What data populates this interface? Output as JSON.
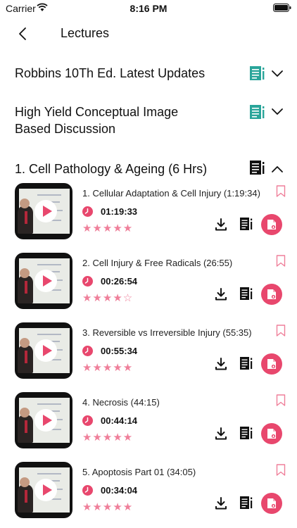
{
  "status_bar": {
    "carrier": "Carrier",
    "time": "8:16 PM"
  },
  "nav": {
    "title": "Lectures"
  },
  "sections": [
    {
      "title": "Robbins 10Th Ed. Latest Updates",
      "expanded": false
    },
    {
      "title": "High Yield Conceptual Image Based Discussion",
      "expanded": false
    },
    {
      "title": "1. Cell Pathology & Ageing (6 Hrs)",
      "expanded": true
    }
  ],
  "lectures": [
    {
      "title": "1. Cellular Adaptation & Cell Injury (1:19:34)",
      "duration": "01:19:33",
      "stars": "★★★★★",
      "rating": 5
    },
    {
      "title": "2. Cell Injury & Free Radicals (26:55)",
      "duration": "00:26:54",
      "stars": "★★★★☆",
      "rating": 4
    },
    {
      "title": "3. Reversible vs Irreversible Injury (55:35)",
      "duration": "00:55:34",
      "stars": "★★★★★",
      "rating": 5
    },
    {
      "title": "4. Necrosis (44:15)",
      "duration": "00:44:14",
      "stars": "★★★★★",
      "rating": 5
    },
    {
      "title": "5. Apoptosis Part 01 (34:05)",
      "duration": "00:34:04",
      "stars": "★★★★★",
      "rating": 5
    }
  ],
  "colors": {
    "accent": "#e8476d",
    "star": "#ef7f9a",
    "notes_teal": "#2aa59a"
  },
  "icons": [
    "back-icon",
    "wifi-icon",
    "battery-icon",
    "notes-icon",
    "chevron-down-icon",
    "chevron-up-icon",
    "play-icon",
    "clock-icon",
    "bookmark-icon",
    "download-icon",
    "pdf-icon"
  ]
}
